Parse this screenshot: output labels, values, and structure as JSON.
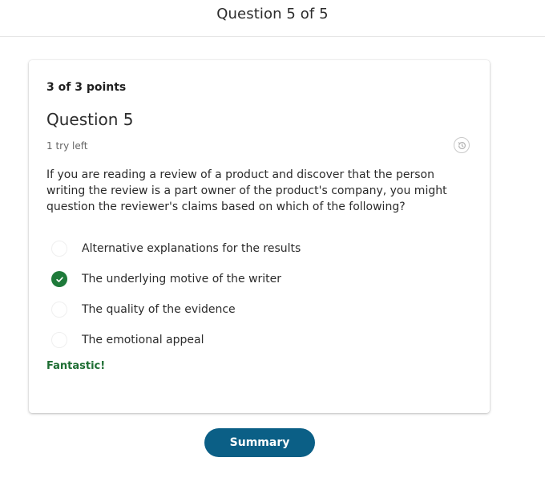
{
  "header": {
    "title": "Question 5 of 5"
  },
  "card": {
    "points": "3 of 3 points",
    "question_title": "Question 5",
    "tries": "1 try left",
    "history_icon": "history-icon",
    "prompt": "If you are reading a review of a product and discover that the person writing the review is a part owner of the product's company, you might question the reviewer's claims based on which of the following?",
    "options": [
      {
        "label": "Alternative explanations for the results",
        "selected": false
      },
      {
        "label": "The underlying motive of the writer",
        "selected": true
      },
      {
        "label": "The quality of the evidence",
        "selected": false
      },
      {
        "label": "The emotional appeal",
        "selected": false
      }
    ],
    "feedback": "Fantastic!"
  },
  "footer": {
    "summary_label": "Summary"
  },
  "colors": {
    "accent": "#0b5f86",
    "correct": "#1e7a3a",
    "feedback": "#1e6e33"
  }
}
